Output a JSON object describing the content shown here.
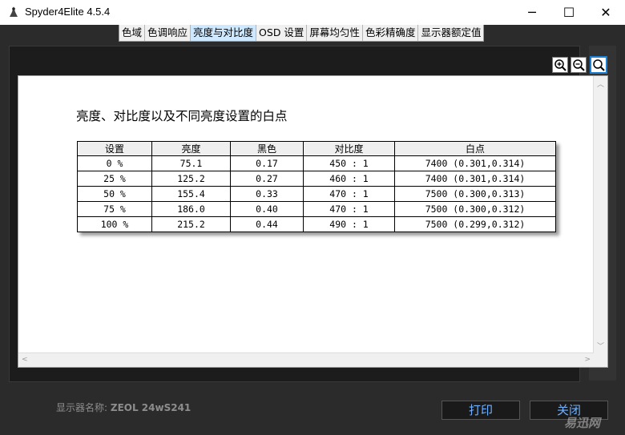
{
  "window": {
    "title": "Spyder4Elite 4.5.4",
    "minimize": "─",
    "maximize": "☐",
    "close": "✕"
  },
  "tabs": [
    "色域",
    "色调响应",
    "亮度与对比度",
    "OSD 设置",
    "屏幕均匀性",
    "色彩精确度",
    "显示器额定值"
  ],
  "active_tab": 2,
  "zoom_icons": [
    "zoom-in-icon",
    "zoom-out-icon",
    "zoom-fit-icon"
  ],
  "report": {
    "heading": "亮度、对比度以及不同亮度设置的白点",
    "columns": [
      "设置",
      "亮度",
      "黑色",
      "对比度",
      "白点"
    ],
    "rows": [
      [
        "0 %",
        "75.1",
        "0.17",
        "450 : 1",
        "7400 (0.301,0.314)"
      ],
      [
        "25 %",
        "125.2",
        "0.27",
        "460 : 1",
        "7400 (0.301,0.314)"
      ],
      [
        "50 %",
        "155.4",
        "0.33",
        "470 : 1",
        "7500 (0.300,0.313)"
      ],
      [
        "75 %",
        "186.0",
        "0.40",
        "470 : 1",
        "7500 (0.300,0.312)"
      ],
      [
        "100 %",
        "215.2",
        "0.44",
        "490 : 1",
        "7500 (0.299,0.312)"
      ]
    ]
  },
  "footer": {
    "monitor_label": "显示器名称:",
    "monitor_name": "ZEOL 24wS241",
    "print_button": "打印",
    "close_button": "关闭"
  },
  "watermark": "易迅网",
  "colors": {
    "accent_tab": "#cde8ff",
    "button_text": "#6fb0ff",
    "background": "#2b2b2b"
  }
}
